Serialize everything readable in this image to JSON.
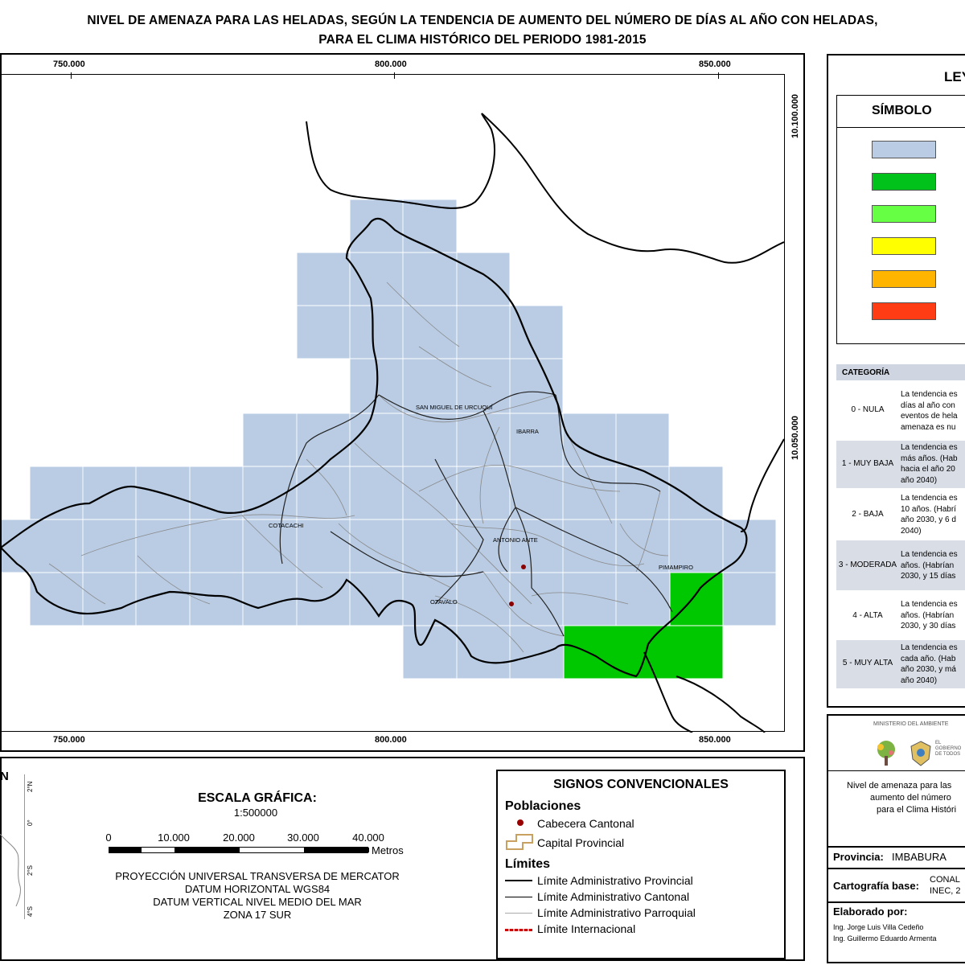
{
  "title": {
    "line1": "NIVEL DE AMENAZA PARA LAS HELADAS, SEGÚN LA TENDENCIA DE AUMENTO DEL NÚMERO DE DÍAS AL AÑO CON HELADAS,",
    "line2": "PARA EL CLIMA HISTÓRICO DEL PERIODO 1981-2015"
  },
  "map": {
    "x_ticks": [
      "750.000",
      "800.000",
      "850.000"
    ],
    "y_ticks": [
      "10.100.000",
      "10.050.000"
    ],
    "places": [
      "SAN MIGUEL DE URCUQUÍ",
      "IBARRA",
      "COTACACHI",
      "ANTONIO ANTE",
      "PIMAMPIRO",
      "OTAVALO"
    ],
    "colors": {
      "grid_nula": "#b9cce4",
      "muy_baja": "#00c800"
    }
  },
  "legend": {
    "title": "LEYENDA",
    "symbol_header": "SÍMBOLO",
    "swatches": [
      "#b9cce4",
      "#00c21a",
      "#66ff44",
      "#ffff00",
      "#ffb400",
      "#ff3c14"
    ],
    "category_header": "CATEGORÍA",
    "categories": [
      {
        "label": "0 - NULA",
        "desc": "La tendencia es\ndías al año con\neventos de hela\namenaza es nu"
      },
      {
        "label": "1 - MUY BAJA",
        "desc": "La tendencia es\nmás años. (Hab\nhacia el año 20\naño 2040)"
      },
      {
        "label": "2 - BAJA",
        "desc": "La tendencia es\n10 años. (Habrí\naño 2030, y 6 d\n2040)"
      },
      {
        "label": "3 - MODERADA",
        "desc": "La tendencia es\naños. (Habrían\n2030, y 15 días"
      },
      {
        "label": "4 - ALTA",
        "desc": "La tendencia es\naños. (Habrían\n2030, y 30 días"
      },
      {
        "label": "5 - MUY ALTA",
        "desc": "La tendencia es\ncada año. (Hab\naño 2030, y má\naño 2040)"
      }
    ]
  },
  "inset": {
    "north_letter": "N",
    "lat_labels": [
      "2°N",
      "0°",
      "2°S",
      "4°S"
    ]
  },
  "scale": {
    "title": "ESCALA GRÁFICA:",
    "ratio": "1:500000",
    "ticks": [
      "0",
      "10.000",
      "20.000",
      "30.000",
      "40.000"
    ],
    "unit": "Metros",
    "projection": [
      "PROYECCIÓN UNIVERSAL TRANSVERSA DE MERCATOR",
      "DATUM HORIZONTAL WGS84",
      "DATUM VERTICAL NIVEL MEDIO DEL MAR",
      "ZONA 17 SUR"
    ]
  },
  "signs": {
    "title": "SIGNOS CONVENCIONALES",
    "populations_header": "Poblaciones",
    "cabecera": "Cabecera Cantonal",
    "capital": "Capital Provincial",
    "limits_header": "Límites",
    "limits": [
      "Límite Administrativo Provincial",
      "Límite Administrativo Cantonal",
      "Límite Administrativo Parroquial",
      "Límite Internacional"
    ]
  },
  "credits": {
    "ministry": "MINISTERIO DEL AMBIENTE",
    "gov_lines": [
      "EL",
      "GOBIERNO",
      "DE TODOS"
    ],
    "desc_lines": [
      "Nivel de amenaza para las",
      "aumento del número",
      "para el Clima Históri"
    ],
    "province_label": "Provincia:",
    "province_value": "IMBABURA",
    "carto_label": "Cartografía base:",
    "carto_value_lines": [
      "CONAL",
      "INEC, 2"
    ],
    "made_by_label": "Elaborado por:",
    "authors": [
      "Ing. Jorge Luis Villa Cedeño",
      "Ing. Guillermo Eduardo Armenta"
    ]
  }
}
